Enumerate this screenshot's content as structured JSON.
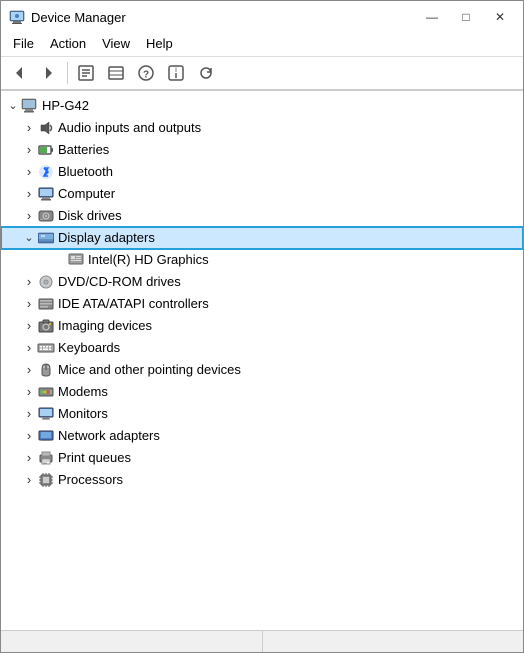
{
  "window": {
    "title": "Device Manager",
    "icon": "🖥",
    "controls": {
      "minimize": "—",
      "maximize": "□",
      "close": "✕"
    }
  },
  "menubar": {
    "items": [
      {
        "label": "File"
      },
      {
        "label": "Action"
      },
      {
        "label": "View"
      },
      {
        "label": "Help"
      }
    ]
  },
  "toolbar": {
    "buttons": [
      {
        "label": "◄",
        "name": "back"
      },
      {
        "label": "►",
        "name": "forward"
      },
      {
        "label": "⊞",
        "name": "properties"
      },
      {
        "label": "▤",
        "name": "list"
      },
      {
        "label": "?",
        "name": "help"
      },
      {
        "label": "⊡",
        "name": "info"
      },
      {
        "label": "⟳",
        "name": "refresh"
      }
    ]
  },
  "tree": {
    "root": {
      "label": "HP-G42",
      "icon": "🖥"
    },
    "items": [
      {
        "label": "Audio inputs and outputs",
        "icon": "🔊",
        "indent": 1,
        "expanded": false,
        "selected": false
      },
      {
        "label": "Batteries",
        "icon": "🔋",
        "indent": 1,
        "expanded": false,
        "selected": false
      },
      {
        "label": "Bluetooth",
        "icon": "◉",
        "indent": 1,
        "expanded": false,
        "selected": false
      },
      {
        "label": "Computer",
        "icon": "🖥",
        "indent": 1,
        "expanded": false,
        "selected": false
      },
      {
        "label": "Disk drives",
        "icon": "💾",
        "indent": 1,
        "expanded": false,
        "selected": false
      },
      {
        "label": "Display adapters",
        "icon": "🖥",
        "indent": 1,
        "expanded": true,
        "selected": true
      },
      {
        "label": "Intel(R) HD Graphics",
        "icon": "⬛",
        "indent": 2,
        "expanded": false,
        "selected": false
      },
      {
        "label": "DVD/CD-ROM drives",
        "icon": "💿",
        "indent": 1,
        "expanded": false,
        "selected": false
      },
      {
        "label": "IDE ATA/ATAPI controllers",
        "icon": "🔌",
        "indent": 1,
        "expanded": false,
        "selected": false
      },
      {
        "label": "Imaging devices",
        "icon": "📷",
        "indent": 1,
        "expanded": false,
        "selected": false
      },
      {
        "label": "Keyboards",
        "icon": "⌨",
        "indent": 1,
        "expanded": false,
        "selected": false
      },
      {
        "label": "Mice and other pointing devices",
        "icon": "🖱",
        "indent": 1,
        "expanded": false,
        "selected": false
      },
      {
        "label": "Modems",
        "icon": "📟",
        "indent": 1,
        "expanded": false,
        "selected": false
      },
      {
        "label": "Monitors",
        "icon": "🖥",
        "indent": 1,
        "expanded": false,
        "selected": false
      },
      {
        "label": "Network adapters",
        "icon": "🌐",
        "indent": 1,
        "expanded": false,
        "selected": false
      },
      {
        "label": "Print queues",
        "icon": "🖨",
        "indent": 1,
        "expanded": false,
        "selected": false
      },
      {
        "label": "Processors",
        "icon": "🔲",
        "indent": 1,
        "expanded": false,
        "selected": false
      }
    ]
  },
  "statusbar": {
    "panes": [
      "",
      ""
    ]
  },
  "icons": {
    "audio": "🔊",
    "battery": "🔋",
    "bluetooth": "⬡",
    "computer": "🖥",
    "disk": "💾",
    "display": "🖵",
    "intel": "▪",
    "dvd": "💿",
    "ide": "⬜",
    "imaging": "📷",
    "keyboard": "⌨",
    "mice": "🖱",
    "modem": "📟",
    "monitor": "🖥",
    "network": "🌐",
    "print": "🖨",
    "processor": "⬜"
  }
}
